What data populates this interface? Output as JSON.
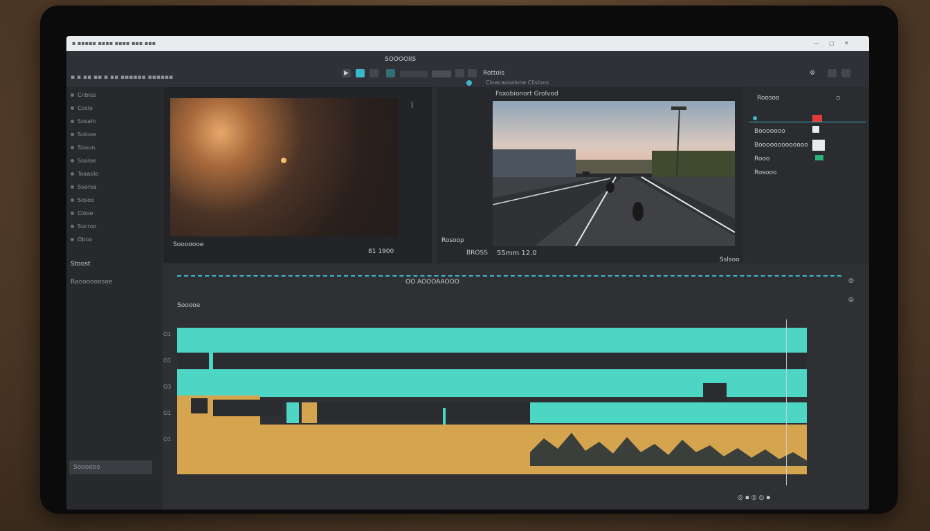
{
  "colors": {
    "accent": "#3ab8c9",
    "video_clip": "#4dd6c4",
    "audio_clip": "#d4a44e",
    "record": "#e23b3b",
    "panel": "#2b2d31"
  },
  "toolbar": {
    "center_title": "SOOOOIIS",
    "mode_label": "Rottois",
    "sub_label": "Cinecaosalone Ciislons"
  },
  "left_panel": {
    "header": "Stoost",
    "bottom_header": "Raoooooosoe",
    "rows": [
      "Cnbios",
      "Coslo",
      "Sosaln",
      "Solooe",
      "Sbuun",
      "Sooloe",
      "Toaaolo",
      "Sooroa",
      "Sosoo",
      "Clooe",
      "Socroo",
      "Oboo"
    ]
  },
  "viewer_left": {
    "label": "Sooooooe",
    "timecode": "81 1900"
  },
  "viewer_right": {
    "title": "Foxobionort Grolvod",
    "timecode": "55mm 12.0",
    "side_label_1": "Rosoop",
    "side_label_2": "BROSS",
    "badge": "Sslsoo"
  },
  "properties": {
    "title": "Roosoo",
    "rows": [
      "Booooooo",
      "Booooooooooooo",
      "Rooo",
      "Rosooo"
    ]
  },
  "timeline": {
    "ruler_label": "OO AOOOAAOOO",
    "sequence_label": "Sooooe",
    "track_labels": [
      "O1",
      "O1",
      "O3",
      "O1",
      "O1"
    ],
    "search_placeholder": "Soooeoo"
  },
  "icons": [
    "play-icon",
    "stop-icon",
    "record-icon",
    "settings-icon",
    "search-icon",
    "zoom-icon",
    "lock-icon",
    "eye-icon"
  ]
}
